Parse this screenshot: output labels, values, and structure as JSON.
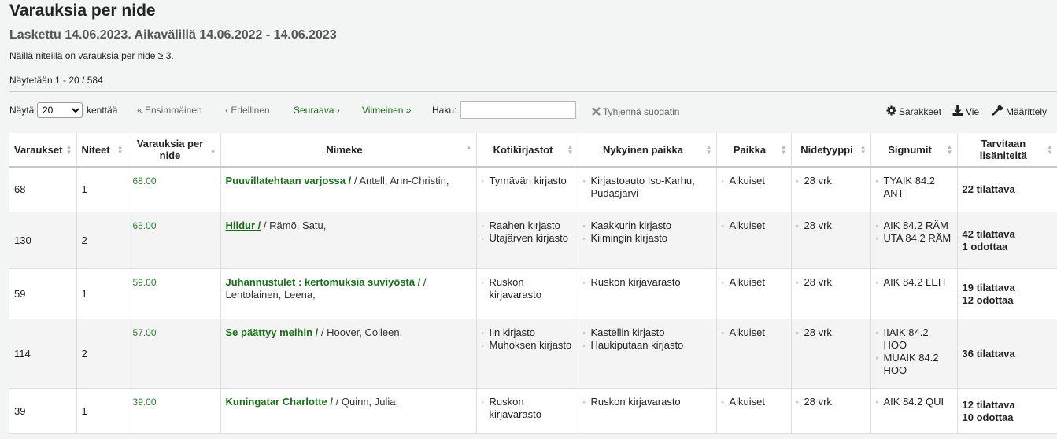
{
  "page": {
    "title": "Varauksia per nide",
    "subtitle": "Laskettu 14.06.2023. Aikavälillä 14.06.2022 - 14.06.2023",
    "note": "Näillä niteillä on varauksia per nide ≥ 3.",
    "count": "Näytetään 1 - 20 / 584"
  },
  "toolbar": {
    "show_label": "Näytä",
    "page_size": "20",
    "entries_label": "kenttää",
    "first": "« Ensimmäinen",
    "prev": "‹ Edellinen",
    "next": "Seuraava ›",
    "last": "Viimeinen »",
    "search_label": "Haku:",
    "search_value": "",
    "clear_filter": "Tyhjennä suodatin",
    "columns": "Sarakkeet",
    "export": "Vie",
    "configure": "Määrittely"
  },
  "icons": {
    "clear": "close-icon",
    "columns": "gear-icon",
    "export": "download-icon",
    "configure": "wrench-icon"
  },
  "table": {
    "headers": [
      "Varaukset",
      "Niteet",
      "Varauksia per nide",
      "Nimeke",
      "Kotikirjastot",
      "Nykyinen paikka",
      "Paikka",
      "Nidetyyppi",
      "Signumit",
      "Tarvitaan lisäniteitä"
    ],
    "rows": [
      {
        "holds": "68",
        "items": "1",
        "ratio": "68.00",
        "title": "Puuvillatehtaan varjossa /",
        "author": "/ Antell, Ann-Christin,",
        "home": [
          "Tyrnävän kirjasto"
        ],
        "current": [
          "Kirjastoauto Iso-Karhu, Pudasjärvi"
        ],
        "location": [
          "Aikuiset"
        ],
        "itype": [
          "28 vrk"
        ],
        "callnumbers": [
          "TYAIK 84.2 ANT"
        ],
        "needs": [
          "22 tilattava"
        ]
      },
      {
        "holds": "130",
        "items": "2",
        "ratio": "65.00",
        "title": "Hildur /",
        "author": "/ Rämö, Satu,",
        "home": [
          "Raahen kirjasto",
          "Utajärven kirjasto"
        ],
        "current": [
          "Kaakkurin kirjasto",
          "Kiimingin kirjasto"
        ],
        "location": [
          "Aikuiset"
        ],
        "itype": [
          "28 vrk"
        ],
        "callnumbers": [
          "AIK 84.2 RÄM",
          "UTA 84.2 RÄM"
        ],
        "needs": [
          "42 tilattava",
          "1 odottaa"
        ]
      },
      {
        "holds": "59",
        "items": "1",
        "ratio": "59.00",
        "title": "Juhannustulet : kertomuksia suviyöstä /",
        "author": "/ Lehtolainen, Leena,",
        "home": [
          "Ruskon kirjavarasto"
        ],
        "current": [
          "Ruskon kirjavarasto"
        ],
        "location": [
          "Aikuiset"
        ],
        "itype": [
          "28 vrk"
        ],
        "callnumbers": [
          "AIK 84.2 LEH"
        ],
        "needs": [
          "19 tilattava",
          "12 odottaa"
        ]
      },
      {
        "holds": "114",
        "items": "2",
        "ratio": "57.00",
        "title": "Se päättyy meihin /",
        "author": "/ Hoover, Colleen,",
        "home": [
          "Iin kirjasto",
          "Muhoksen kirjasto"
        ],
        "current": [
          "Kastellin kirjasto",
          "Haukiputaan kirjasto"
        ],
        "location": [
          "Aikuiset"
        ],
        "itype": [
          "28 vrk"
        ],
        "callnumbers": [
          "IIAIK 84.2 HOO",
          "MUAIK 84.2 HOO"
        ],
        "needs": [
          "36 tilattava"
        ]
      },
      {
        "holds": "39",
        "items": "1",
        "ratio": "39.00",
        "title": "Kuningatar Charlotte /",
        "author": "/ Quinn, Julia,",
        "home": [
          "Ruskon kirjavarasto"
        ],
        "current": [
          "Ruskon kirjavarasto"
        ],
        "location": [
          "Aikuiset"
        ],
        "itype": [
          "28 vrk"
        ],
        "callnumbers": [
          "AIK 84.2 QUI"
        ],
        "needs": [
          "12 tilattava",
          "10 odottaa"
        ]
      }
    ]
  }
}
